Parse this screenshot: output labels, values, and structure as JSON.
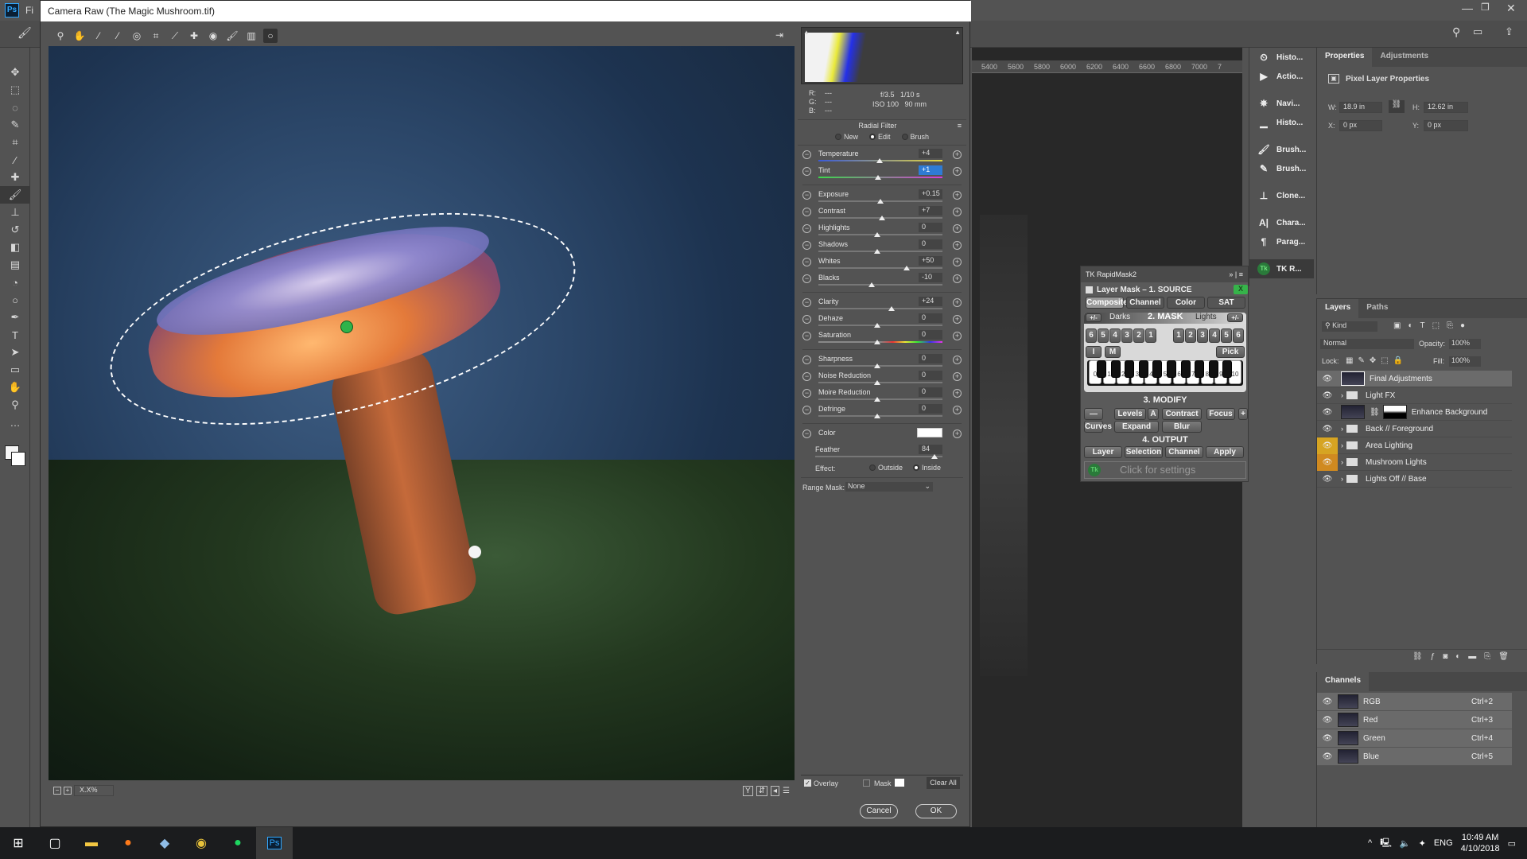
{
  "photoshop": {
    "app_icon": "Ps",
    "menu_partial": "Fi",
    "window_controls": [
      "minimize",
      "restore",
      "close"
    ],
    "ruler_ticks": [
      "5400",
      "5600",
      "5800",
      "6000",
      "6200",
      "6400",
      "6600",
      "6800",
      "7000",
      "7"
    ],
    "toolbar_tools": [
      "move-icon",
      "marquee-icon",
      "lasso-icon",
      "quick-select-icon",
      "crop-icon",
      "eyedropper-icon",
      "healing-icon",
      "brush-icon",
      "stamp-icon",
      "history-brush-icon",
      "eraser-icon",
      "gradient-icon",
      "blur-icon",
      "dodge-icon",
      "pen-icon",
      "type-icon",
      "path-select-icon",
      "shape-icon",
      "hand-icon",
      "zoom-icon",
      "more-icon"
    ]
  },
  "camera_raw": {
    "title": "Camera Raw (The Magic Mushroom.tif)",
    "tools": [
      "zoom",
      "hand",
      "white-balance",
      "color-sampler",
      "target-adjust",
      "crop",
      "straighten",
      "spot-removal",
      "red-eye",
      "adjustment-brush",
      "graduated-filter",
      "radial-filter"
    ],
    "zoom_level": "X.X%",
    "camera_info": {
      "r": "---",
      "g": "---",
      "b": "---",
      "aperture": "f/3.5",
      "shutter": "1/10 s",
      "iso": "ISO 100",
      "focal": "90 mm"
    },
    "panel_title": "Radial Filter",
    "modes": [
      {
        "label": "New",
        "on": false
      },
      {
        "label": "Edit",
        "on": true
      },
      {
        "label": "Brush",
        "on": false
      }
    ],
    "sliders_group1": [
      {
        "label": "Temperature",
        "value": "+4",
        "pos": 0.52,
        "selected": false
      },
      {
        "label": "Tint",
        "value": "+1",
        "pos": 0.505,
        "selected": true
      }
    ],
    "sliders_group2": [
      {
        "label": "Exposure",
        "value": "+0.15",
        "pos": 0.53
      },
      {
        "label": "Contrast",
        "value": "+7",
        "pos": 0.54
      },
      {
        "label": "Highlights",
        "value": "0",
        "pos": 0.5
      },
      {
        "label": "Shadows",
        "value": "0",
        "pos": 0.5
      },
      {
        "label": "Whites",
        "value": "+50",
        "pos": 0.75
      },
      {
        "label": "Blacks",
        "value": "-10",
        "pos": 0.45
      }
    ],
    "sliders_group3": [
      {
        "label": "Clarity",
        "value": "+24",
        "pos": 0.62
      },
      {
        "label": "Dehaze",
        "value": "0",
        "pos": 0.5
      },
      {
        "label": "Saturation",
        "value": "0",
        "pos": 0.5
      }
    ],
    "sliders_group4": [
      {
        "label": "Sharpness",
        "value": "0",
        "pos": 0.5
      },
      {
        "label": "Noise Reduction",
        "value": "0",
        "pos": 0.5
      },
      {
        "label": "Moire Reduction",
        "value": "0",
        "pos": 0.5
      },
      {
        "label": "Defringe",
        "value": "0",
        "pos": 0.5
      }
    ],
    "color_label": "Color",
    "feather_label": "Feather",
    "feather_value": "84",
    "effect_label": "Effect:",
    "effect_options": [
      {
        "label": "Outside",
        "on": false
      },
      {
        "label": "Inside",
        "on": true
      }
    ],
    "range_mask_label": "Range Mask:",
    "range_mask_value": "None",
    "overlay_label": "Overlay",
    "overlay_checked": true,
    "mask_label": "Mask",
    "mask_checked": false,
    "clear_all": "Clear All",
    "cancel": "Cancel",
    "ok": "OK"
  },
  "panel_strip": [
    {
      "icon": "history-icon",
      "label": "Histo..."
    },
    {
      "icon": "actions-icon",
      "label": "Actio..."
    },
    {
      "icon": "navigator-icon",
      "label": "Navi..."
    },
    {
      "icon": "histogram-icon",
      "label": "Histo..."
    },
    {
      "icon": "brush-settings-icon",
      "label": "Brush..."
    },
    {
      "icon": "brushes-icon",
      "label": "Brush..."
    },
    {
      "icon": "clone-source-icon",
      "label": "Clone..."
    },
    {
      "icon": "character-icon",
      "label": "Chara..."
    },
    {
      "icon": "paragraph-icon",
      "label": "Parag..."
    },
    {
      "icon": "tk-icon",
      "label": "TK R..."
    }
  ],
  "properties": {
    "tabs": [
      "Properties",
      "Adjustments"
    ],
    "header": "Pixel Layer Properties",
    "w_label": "W:",
    "w": "18.9 in",
    "h_label": "H:",
    "h": "12.62 in",
    "x_label": "X:",
    "x": "0 px",
    "y_label": "Y:",
    "y": "0 px"
  },
  "tk_rapidmask": {
    "title": "TK RapidMask2",
    "source_label": "Layer Mask – 1. SOURCE",
    "x_btn": "X",
    "source_buttons": [
      "Composite",
      "Channel",
      "Color",
      "SAT"
    ],
    "mask_header": "2. MASK",
    "darks": "Darks",
    "lights": "Lights",
    "pm": "+/-",
    "dark_keys": [
      "6",
      "5",
      "4",
      "3",
      "2",
      "1"
    ],
    "light_keys": [
      "1",
      "2",
      "3",
      "4",
      "5",
      "6"
    ],
    "i_btn": "I",
    "m_btn": "M",
    "pick": "Pick",
    "zone_keys": [
      "0",
      "1",
      "2",
      "3",
      "4",
      "5",
      "6",
      "7",
      "8",
      "9",
      "10"
    ],
    "modify_header": "3. MODIFY",
    "modify_buttons": [
      "—",
      "Levels",
      "A",
      "Contract",
      "Focus",
      "+",
      "Curves",
      "Expand",
      "Blur"
    ],
    "output_header": "4. OUTPUT",
    "output_buttons": [
      "Layer",
      "Selection",
      "Channel",
      "Apply"
    ],
    "settings": "Click for settings"
  },
  "layers": {
    "tabs": [
      "Layers",
      "Paths"
    ],
    "filter": "Kind",
    "blend_mode": "Normal",
    "opacity_label": "Opacity:",
    "opacity": "100%",
    "lock_label": "Lock:",
    "fill_label": "Fill:",
    "fill": "100%",
    "items": [
      {
        "name": "Final Adjustments",
        "type": "pixel",
        "eye": "normal",
        "selected": true
      },
      {
        "name": "Light FX",
        "type": "group",
        "eye": "normal",
        "selected": false
      },
      {
        "name": "Enhance Background",
        "type": "masked",
        "eye": "normal",
        "selected": false
      },
      {
        "name": "Back // Foreground",
        "type": "group",
        "eye": "normal",
        "selected": false
      },
      {
        "name": "Area Lighting",
        "type": "group",
        "eye": "yellow",
        "selected": false
      },
      {
        "name": "Mushroom Lights",
        "type": "group",
        "eye": "orange",
        "selected": false
      },
      {
        "name": "Lights Off // Base",
        "type": "group",
        "eye": "normal",
        "selected": false
      }
    ]
  },
  "channels": {
    "title": "Channels",
    "items": [
      {
        "name": "RGB",
        "shortcut": "Ctrl+2"
      },
      {
        "name": "Red",
        "shortcut": "Ctrl+3"
      },
      {
        "name": "Green",
        "shortcut": "Ctrl+4"
      },
      {
        "name": "Blue",
        "shortcut": "Ctrl+5"
      }
    ]
  },
  "taskbar": {
    "apps": [
      "start",
      "task-view",
      "file-explorer",
      "firefox",
      "notes",
      "chrome",
      "spotify",
      "photoshop"
    ],
    "ps_label": "Ps",
    "lang": "ENG",
    "time": "10:49 AM",
    "date": "4/10/2018"
  }
}
